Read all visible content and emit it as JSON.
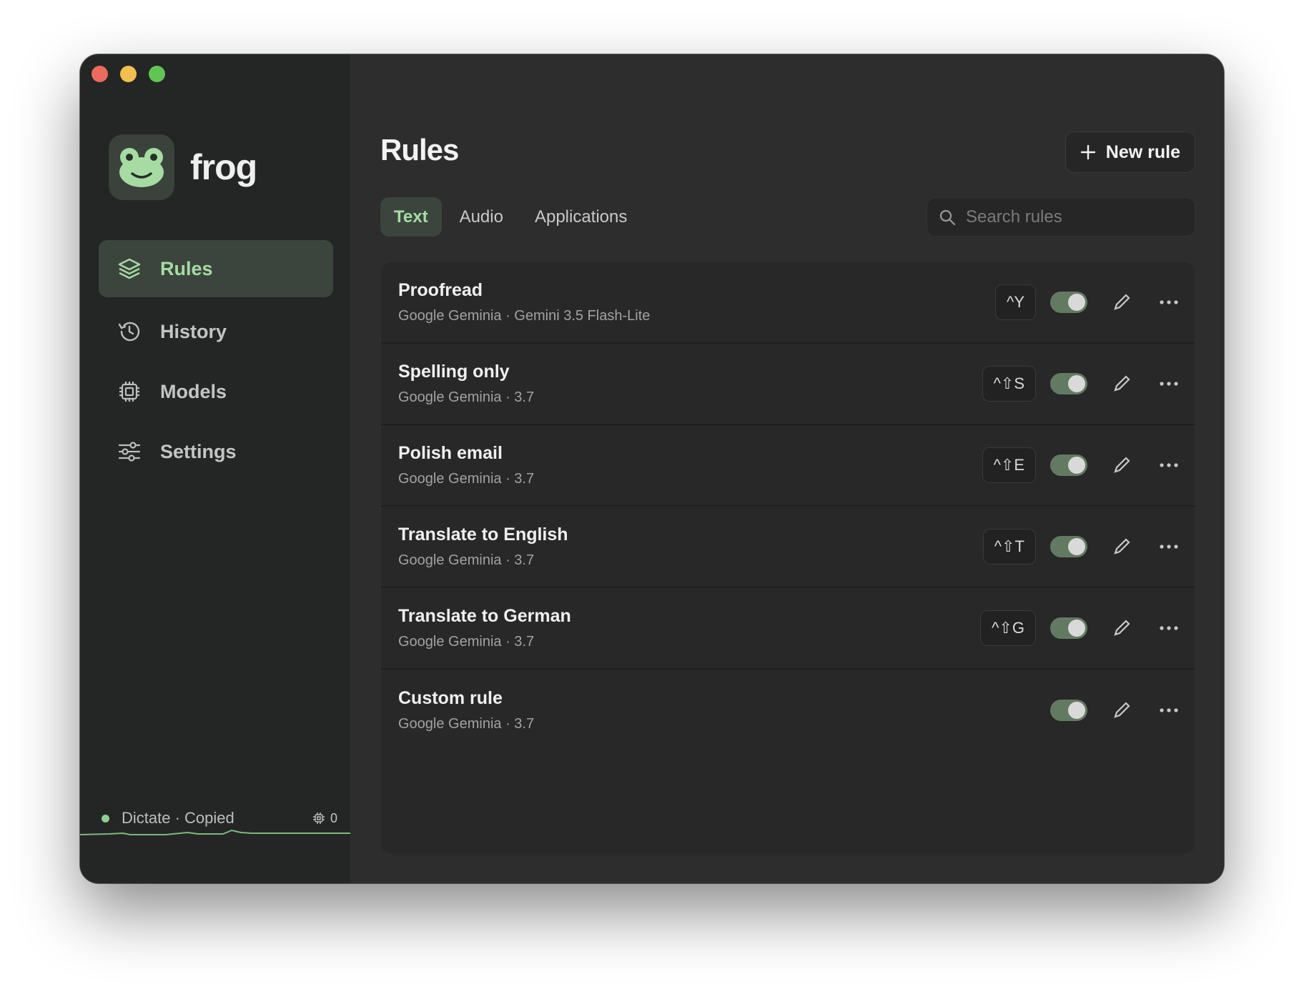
{
  "app": {
    "name": "frog"
  },
  "sidebar": {
    "items": [
      {
        "label": "Rules",
        "icon": "layers-icon",
        "active": true
      },
      {
        "label": "History",
        "icon": "history-icon",
        "active": false
      },
      {
        "label": "Models",
        "icon": "chip-icon",
        "active": false
      },
      {
        "label": "Settings",
        "icon": "sliders-icon",
        "active": false
      }
    ],
    "status": {
      "text": "Dictate · Copied",
      "count": "0"
    }
  },
  "main": {
    "title": "Rules",
    "new_rule_label": "New rule",
    "tabs": [
      {
        "label": "Text",
        "active": true
      },
      {
        "label": "Audio",
        "active": false
      },
      {
        "label": "Applications",
        "active": false
      }
    ],
    "search": {
      "placeholder": "Search rules",
      "value": ""
    }
  },
  "rules": [
    {
      "name": "Proofread",
      "subtitle": "Google Geminia · Gemini 3.5 Flash-Lite",
      "shortcut": "^Y",
      "enabled": true
    },
    {
      "name": "Spelling only",
      "subtitle": "Google Geminia · 3.7",
      "shortcut": "^⇧S",
      "enabled": true
    },
    {
      "name": "Polish email",
      "subtitle": "Google Geminia · 3.7",
      "shortcut": "^⇧E",
      "enabled": true
    },
    {
      "name": "Translate to English",
      "subtitle": "Google Geminia · 3.7",
      "shortcut": "^⇧T",
      "enabled": true
    },
    {
      "name": "Translate to German",
      "subtitle": "Google Geminia · 3.7",
      "shortcut": "^⇧G",
      "enabled": true
    },
    {
      "name": "Custom rule",
      "subtitle": "Google Geminia · 3.7",
      "shortcut": "",
      "enabled": true
    }
  ],
  "colors": {
    "accent": "#a6dba4",
    "active_bg": "#3b453d",
    "toggle_on": "#637a62",
    "status_dot": "#8fcf8d"
  }
}
